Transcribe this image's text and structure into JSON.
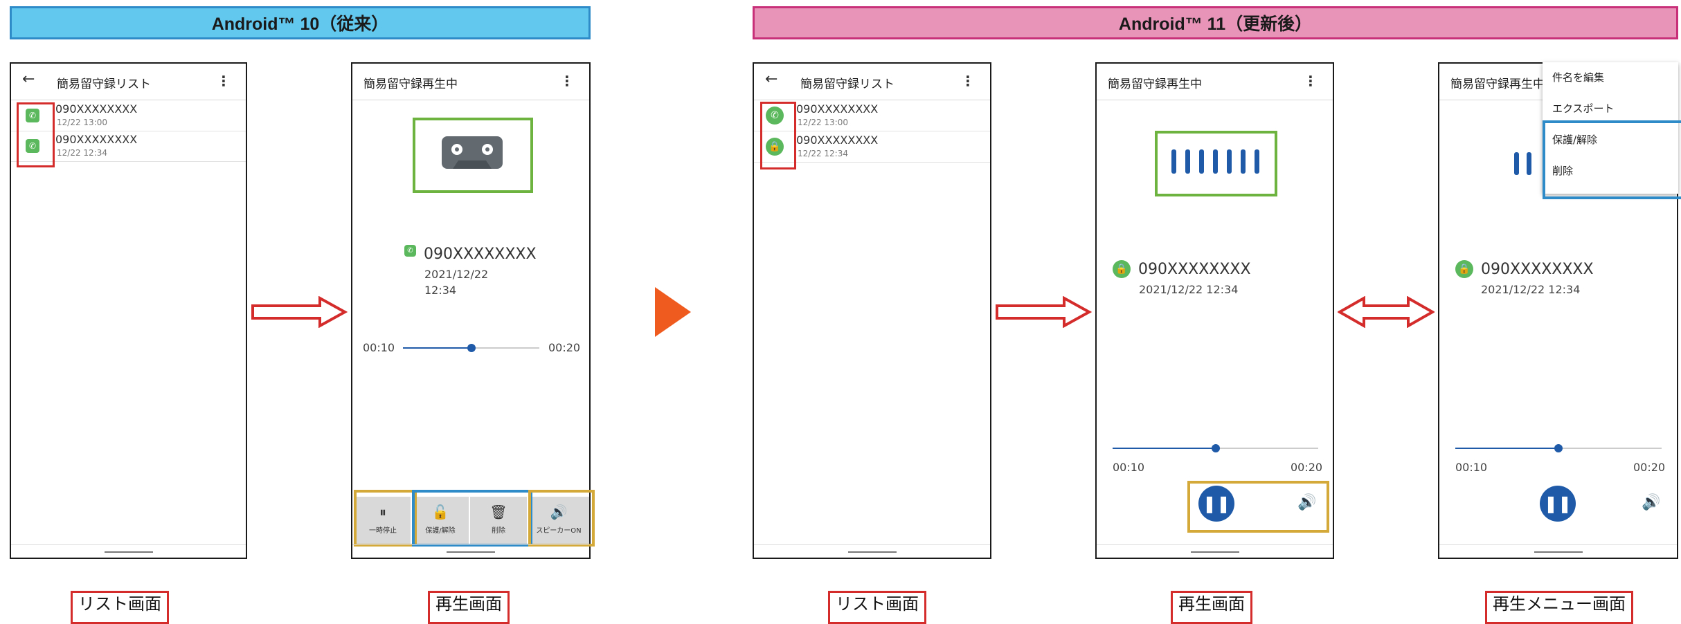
{
  "banners": {
    "android10": "Android™ 10（従来）",
    "android11": "Android™ 11（更新後）"
  },
  "colors": {
    "blue_banner": "#63c8ee",
    "pink_banner": "#e893b8",
    "red": "#d42b2b",
    "green": "#6db33f",
    "gold": "#d4a839",
    "blue": "#2e8bc7",
    "accent": "#1e5aa8",
    "orange": "#ef5a1f"
  },
  "list_screen": {
    "title": "簡易留守録リスト",
    "items": [
      {
        "number": "090XXXXXXXX",
        "date": "12/22 13:00",
        "icon": "phone-icon"
      },
      {
        "number": "090XXXXXXXX",
        "date": "12/22 12:34",
        "icon": "phone-icon"
      }
    ]
  },
  "playback_old": {
    "title": "簡易留守録再生中",
    "number": "090XXXXXXXX",
    "date": "2021/12/22",
    "time": "12:34",
    "elapsed": "00:10",
    "total": "00:20",
    "progress": 0.5,
    "controls": {
      "pause": "一時停止",
      "protect": "保護/解除",
      "delete": "削除",
      "speaker": "スピーカーON"
    }
  },
  "list_screen_new": {
    "title": "簡易留守録リスト",
    "items": [
      {
        "number": "090XXXXXXXX",
        "date": "12/22 13:00",
        "icon": "phone-icon"
      },
      {
        "number": "090XXXXXXXX",
        "date": "12/22 12:34",
        "icon": "lock-icon"
      }
    ]
  },
  "playback_new": {
    "title": "簡易留守録再生中",
    "number": "090XXXXXXXX",
    "datetime": "2021/12/22 12:34",
    "elapsed": "00:10",
    "total": "00:20",
    "progress": 0.5
  },
  "menu_screen": {
    "title": "簡易留守録再生中",
    "menu": [
      "件名を編集",
      "エクスポート",
      "保護/解除",
      "削除"
    ],
    "number": "090XXXXXXXX",
    "datetime": "2021/12/22 12:34",
    "elapsed": "00:10",
    "total": "00:20",
    "progress": 0.5
  },
  "captions": {
    "list1": "リスト画面",
    "play1": "再生画面",
    "list2": "リスト画面",
    "play2": "再生画面",
    "menu": "再生メニュー画面"
  }
}
